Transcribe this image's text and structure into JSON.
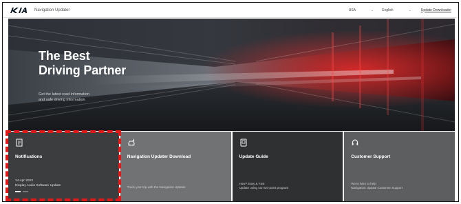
{
  "header": {
    "brand": "KIA",
    "site_name": "Navigation Updater",
    "region": "USA",
    "language": "English",
    "link": "Update Downloader"
  },
  "hero": {
    "title_line1": "The Best",
    "title_line2": "Driving Partner",
    "subtitle_line1": "Get the latest road information",
    "subtitle_line2": "and safe driving information"
  },
  "tiles": [
    {
      "icon": "document-icon",
      "title": "Notifications",
      "date": "14 Apr 2023",
      "news": "Display Audio Software Update"
    },
    {
      "icon": "car-download-icon",
      "title": "Navigation Updater Download",
      "desc": "Track your trip with the Navigation Updater"
    },
    {
      "icon": "guide-book-icon",
      "title": "Update Guide",
      "desc_line1": "How? Easy & Fast",
      "desc_line2": "Update using our two-point program"
    },
    {
      "icon": "headset-icon",
      "title": "Customer Support",
      "desc_line1": "We're here to help",
      "desc_line2": "Navigation Update Customer Support"
    }
  ],
  "colors": {
    "highlight": "#e01818",
    "tile_dark": "#3c3d3f",
    "tile_light": "#717273"
  }
}
